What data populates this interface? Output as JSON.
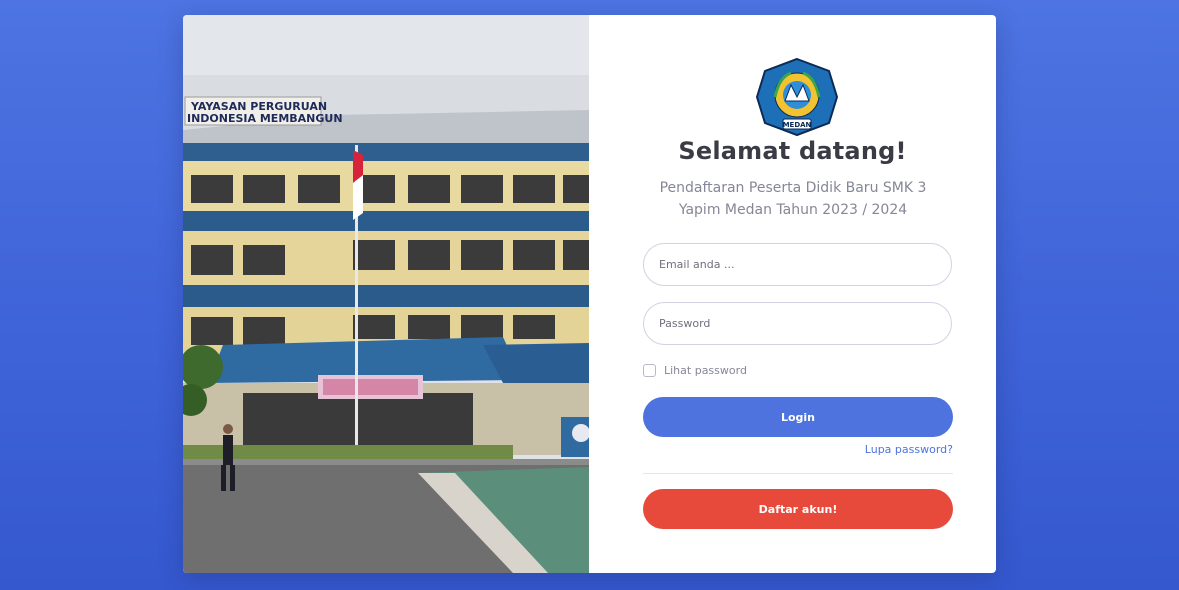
{
  "logo": {
    "text": "MEDAN"
  },
  "photo": {
    "banner_line1": "YAYASAN PERGURUAN",
    "banner_line2": "INDONESIA MEMBANGUN"
  },
  "login": {
    "title": "Selamat datang!",
    "subtitle": "Pendaftaran Peserta Didik Baru SMK 3 Yapim Medan Tahun 2023 / 2024",
    "email_placeholder": "Email anda ...",
    "password_placeholder": "Password",
    "show_password_label": "Lihat password",
    "login_button": "Login",
    "forgot_password": "Lupa password?",
    "register_button": "Daftar akun!"
  },
  "colors": {
    "primary": "#4e73df",
    "danger": "#e74a3b",
    "background": "#4d74e2"
  }
}
